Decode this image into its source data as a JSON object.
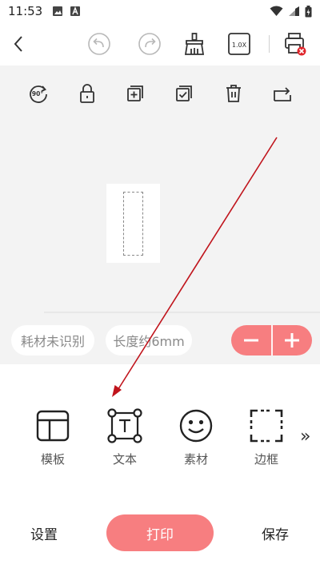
{
  "status_bar": {
    "time": "11:53",
    "notification_icons": [
      "image-icon",
      "font-app-icon"
    ],
    "system_icons": [
      "wifi-icon",
      "signal-icon",
      "battery-icon"
    ]
  },
  "toolbar": {
    "back_icon": "chevron-left-icon",
    "undo_icon": "undo-icon",
    "redo_icon": "redo-icon",
    "clear_icon": "brush-icon",
    "zoom_label": "1.0X",
    "printer_icon": "printer-disconnected-icon"
  },
  "edit_tools": [
    "rotate-90-icon",
    "lock-icon",
    "copy-add-icon",
    "copy-check-icon",
    "delete-icon",
    "flip-icon"
  ],
  "edit_rotate_label": "90°",
  "canvas": {
    "consumable_status": "耗材未识别",
    "length_label": "长度约6mm"
  },
  "menu": {
    "items": [
      {
        "label": "模板",
        "icon": "template-icon"
      },
      {
        "label": "文本",
        "icon": "text-icon"
      },
      {
        "label": "素材",
        "icon": "smiley-icon"
      },
      {
        "label": "边框",
        "icon": "border-icon"
      }
    ],
    "more_label": "»"
  },
  "actions": {
    "settings_label": "设置",
    "print_label": "打印",
    "save_label": "保存"
  },
  "colors": {
    "accent": "#f77e80",
    "canvas_bg": "#f3f3f3",
    "annotation": "#c0141c"
  }
}
